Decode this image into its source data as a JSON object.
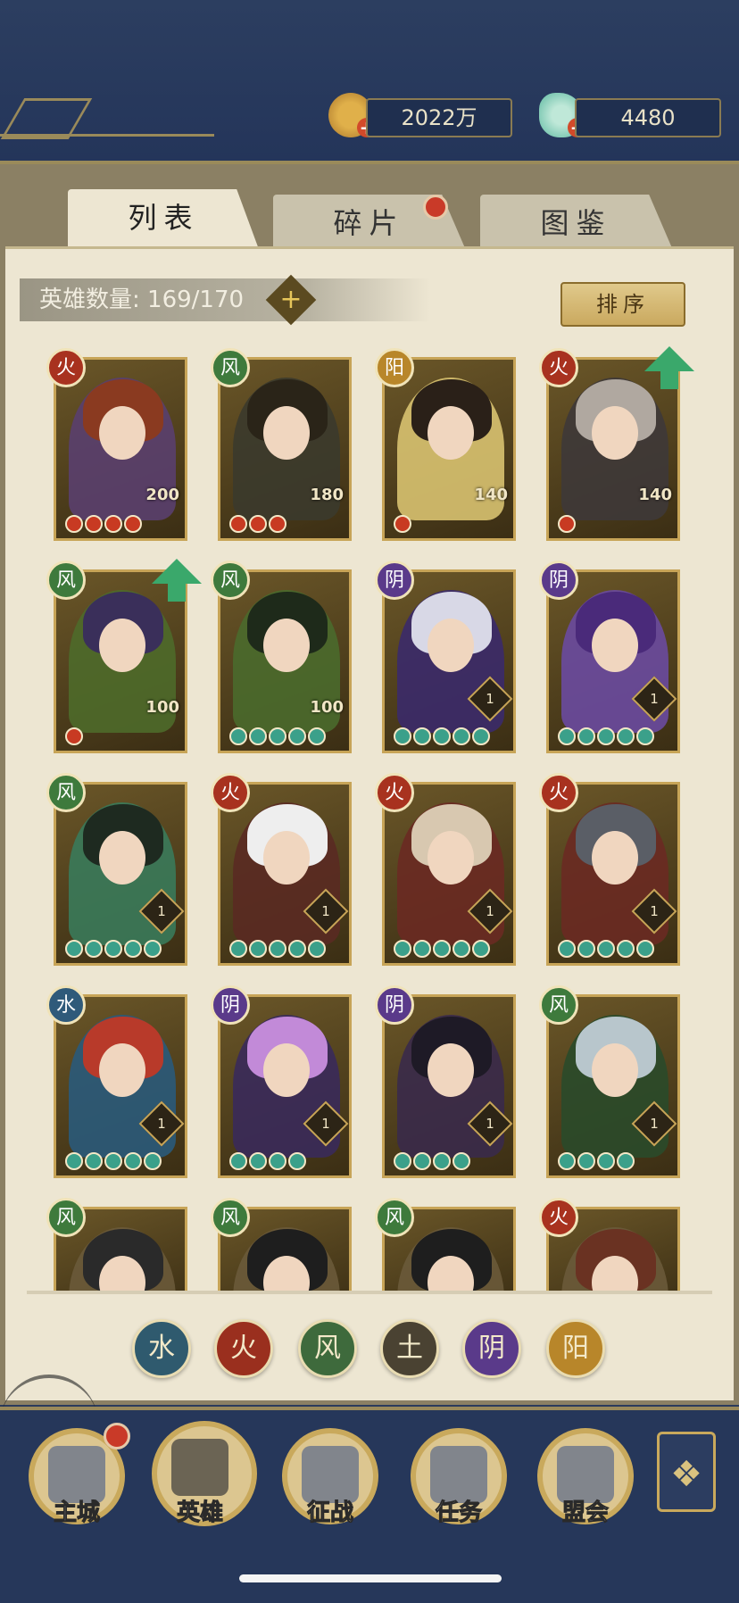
{
  "resources": {
    "gold": "2022万",
    "jade": "4480"
  },
  "tabs": [
    {
      "label": "列表",
      "active": true
    },
    {
      "label": "碎片",
      "active": false,
      "badge": true
    },
    {
      "label": "图鉴",
      "active": false
    }
  ],
  "hero_count": {
    "label": "英雄数量: 169/170"
  },
  "sort_label": "排序",
  "heroes": [
    {
      "element": "火",
      "elem_color": "#a8321f",
      "level": "200",
      "stars": 4,
      "star_type": "red",
      "upgrade": false,
      "hair": "#8a3a20",
      "bg": "#5a3f6e"
    },
    {
      "element": "风",
      "elem_color": "#3e7a3c",
      "level": "180",
      "stars": 3,
      "star_type": "red",
      "upgrade": false,
      "hair": "#2a2418",
      "bg": "#3b3a2c"
    },
    {
      "element": "阳",
      "elem_color": "#b8862a",
      "level": "140",
      "stars": 1,
      "star_type": "red",
      "upgrade": false,
      "hair": "#2a2018",
      "bg": "#d8c270"
    },
    {
      "element": "火",
      "elem_color": "#a8321f",
      "level": "140",
      "stars": 1,
      "star_type": "red",
      "upgrade": true,
      "hair": "#b0a8a0",
      "bg": "#3e3838"
    },
    {
      "element": "风",
      "elem_color": "#3e7a3c",
      "level": "100",
      "stars": 1,
      "star_type": "red",
      "upgrade": true,
      "hair": "#3a2f5a",
      "bg": "#4e6a2a"
    },
    {
      "element": "风",
      "elem_color": "#3e7a3c",
      "level": "100",
      "stars": 5,
      "star_type": "jade",
      "upgrade": false,
      "hair": "#1e2a1a",
      "bg": "#4a6a2c"
    },
    {
      "element": "阴",
      "elem_color": "#5a3a8a",
      "level": "1",
      "stars": 5,
      "star_type": "jade",
      "upgrade": false,
      "hair": "#d8d8e6",
      "bg": "#3b2a6a"
    },
    {
      "element": "阴",
      "elem_color": "#5a3a8a",
      "level": "1",
      "stars": 5,
      "star_type": "jade",
      "upgrade": false,
      "hair": "#4a2a7a",
      "bg": "#6a4aa0"
    },
    {
      "element": "风",
      "elem_color": "#3e7a3c",
      "level": "1",
      "stars": 5,
      "star_type": "jade",
      "upgrade": false,
      "hair": "#1e2a20",
      "bg": "#3a7a5a"
    },
    {
      "element": "火",
      "elem_color": "#a8321f",
      "level": "1",
      "stars": 5,
      "star_type": "jade",
      "upgrade": false,
      "hair": "#eeeeee",
      "bg": "#5a2a22"
    },
    {
      "element": "火",
      "elem_color": "#a8321f",
      "level": "1",
      "stars": 5,
      "star_type": "jade",
      "upgrade": false,
      "hair": "#d8c8b0",
      "bg": "#6a2a22"
    },
    {
      "element": "火",
      "elem_color": "#a8321f",
      "level": "1",
      "stars": 5,
      "star_type": "jade",
      "upgrade": false,
      "hair": "#5a5e66",
      "bg": "#6a2a22"
    },
    {
      "element": "水",
      "elem_color": "#2f5a7a",
      "level": "1",
      "stars": 5,
      "star_type": "jade",
      "upgrade": false,
      "hair": "#b83a2a",
      "bg": "#2a5a7a"
    },
    {
      "element": "阴",
      "elem_color": "#5a3a8a",
      "level": "1",
      "stars": 4,
      "star_type": "jade",
      "upgrade": false,
      "hair": "#c28ad8",
      "bg": "#3a2a5a"
    },
    {
      "element": "阴",
      "elem_color": "#5a3a8a",
      "level": "1",
      "stars": 4,
      "star_type": "jade",
      "upgrade": false,
      "hair": "#1e1a26",
      "bg": "#3a2a4a"
    },
    {
      "element": "风",
      "elem_color": "#3e7a3c",
      "level": "1",
      "stars": 4,
      "star_type": "jade",
      "upgrade": false,
      "hair": "#b8c6cc",
      "bg": "#2a4a2a"
    },
    {
      "element": "风",
      "elem_color": "#3e7a3c",
      "level": "",
      "stars": 0,
      "star_type": "jade",
      "upgrade": false,
      "hair": "#2a2a2a",
      "bg": "#6a5a3a"
    },
    {
      "element": "风",
      "elem_color": "#3e7a3c",
      "level": "",
      "stars": 0,
      "star_type": "jade",
      "upgrade": false,
      "hair": "#1e1e1e",
      "bg": "#6a5a3a"
    },
    {
      "element": "风",
      "elem_color": "#3e7a3c",
      "level": "",
      "stars": 0,
      "star_type": "jade",
      "upgrade": false,
      "hair": "#1e1e1e",
      "bg": "#6a5a3a"
    },
    {
      "element": "火",
      "elem_color": "#a8321f",
      "level": "",
      "stars": 0,
      "star_type": "jade",
      "upgrade": false,
      "hair": "#6a3222",
      "bg": "#6a5a3a"
    }
  ],
  "filters": [
    {
      "glyph": "水",
      "color": "#2f5a6e"
    },
    {
      "glyph": "火",
      "color": "#9a2f1e"
    },
    {
      "glyph": "风",
      "color": "#3e6a3c"
    },
    {
      "glyph": "土",
      "color": "#4a4232"
    },
    {
      "glyph": "阴",
      "color": "#5a3a8a"
    },
    {
      "glyph": "阳",
      "color": "#b8862a"
    }
  ],
  "nav": [
    {
      "label": "主城",
      "badge": true
    },
    {
      "label": "英雄",
      "badge": false
    },
    {
      "label": "征战",
      "badge": false
    },
    {
      "label": "任务",
      "badge": false
    },
    {
      "label": "盟会",
      "badge": false
    }
  ],
  "more_icon": "menu-grid-icon"
}
